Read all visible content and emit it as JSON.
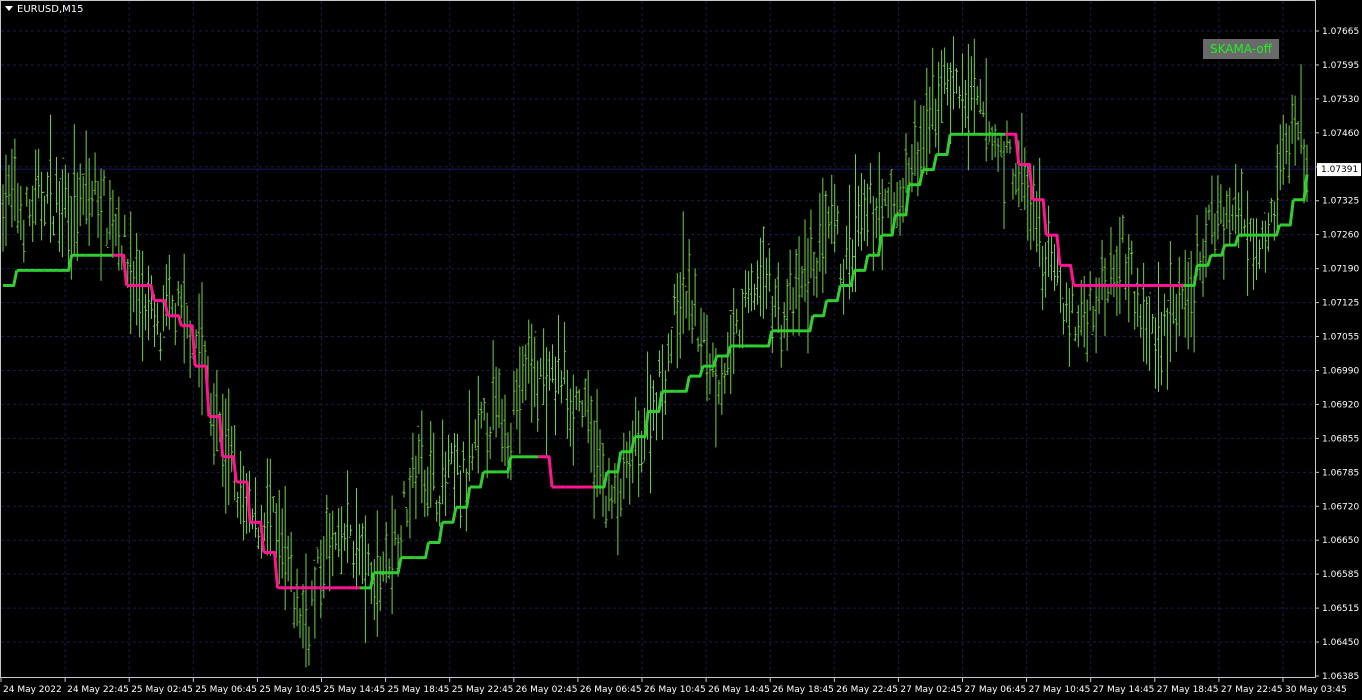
{
  "header": {
    "symbol": "EURUSD,M15"
  },
  "indicator_badge": {
    "label": "SKAMA-off",
    "color": "#1cf21c"
  },
  "colors": {
    "background": "#000000",
    "bars": "#6fd43a",
    "line_up": "#32cd32",
    "line_down": "#ff1493",
    "grid": "#1a1a4a",
    "price_line": "#1a1a6a",
    "text": "#ffffff"
  },
  "chart_data": {
    "type": "line",
    "title": "EURUSD,M15",
    "grid": true,
    "ylim": [
      1.0638,
      1.0772
    ],
    "y_ticks": [
      "1.07665",
      "1.07595",
      "1.07530",
      "1.07460",
      "1.07391",
      "1.07325",
      "1.07260",
      "1.07190",
      "1.07125",
      "1.07055",
      "1.06990",
      "1.06920",
      "1.06855",
      "1.06785",
      "1.06720",
      "1.06650",
      "1.06585",
      "1.06515",
      "1.06450",
      "1.06385"
    ],
    "x_ticks": [
      "24 May 2022",
      "24 May 22:45",
      "25 May 02:45",
      "25 May 06:45",
      "25 May 10:45",
      "25 May 14:45",
      "25 May 18:45",
      "25 May 22:45",
      "26 May 02:45",
      "26 May 06:45",
      "26 May 10:45",
      "26 May 14:45",
      "26 May 18:45",
      "26 May 22:45",
      "27 May 02:45",
      "27 May 06:45",
      "27 May 10:45",
      "27 May 14:45",
      "27 May 18:45",
      "27 May 22:45",
      "30 May 03:45"
    ],
    "current_price": "1.07391",
    "price_trace": [
      1.0734,
      1.0733,
      1.0729,
      1.0731,
      1.0735,
      1.0732,
      1.0734,
      1.073,
      1.0733,
      1.0734,
      1.073,
      1.0728,
      1.0719,
      1.0715,
      1.071,
      1.0705,
      1.0712,
      1.0709,
      1.0707,
      1.0703,
      1.069,
      1.0685,
      1.0678,
      1.0671,
      1.0668,
      1.0672,
      1.0666,
      1.066,
      1.0652,
      1.065,
      1.0658,
      1.0665,
      1.0663,
      1.0668,
      1.0662,
      1.0656,
      1.066,
      1.0664,
      1.067,
      1.0678,
      1.0682,
      1.0676,
      1.0677,
      1.0679,
      1.0676,
      1.0684,
      1.0689,
      1.0691,
      1.0688,
      1.0694,
      1.07,
      1.0698,
      1.0695,
      1.0699,
      1.0694,
      1.0693,
      1.0685,
      1.0678,
      1.0672,
      1.0676,
      1.0683,
      1.0687,
      1.0694,
      1.07,
      1.071,
      1.0716,
      1.0708,
      1.0702,
      1.0698,
      1.07,
      1.0707,
      1.0714,
      1.0718,
      1.0716,
      1.0708,
      1.0712,
      1.0716,
      1.072,
      1.0724,
      1.0727,
      1.0718,
      1.0725,
      1.0729,
      1.0732,
      1.073,
      1.0733,
      1.0737,
      1.0742,
      1.0746,
      1.0755,
      1.0757,
      1.0754,
      1.0752,
      1.075,
      1.0745,
      1.0742,
      1.074,
      1.0736,
      1.0729,
      1.0722,
      1.0718,
      1.0712,
      1.0708,
      1.071,
      1.0714,
      1.0718,
      1.0724,
      1.0722,
      1.071,
      1.0707,
      1.0706,
      1.0712,
      1.0709,
      1.0714,
      1.072,
      1.073,
      1.0731,
      1.0729,
      1.073,
      1.0727,
      1.0728,
      1.0733,
      1.0743,
      1.0749,
      1.074
    ],
    "series": [
      {
        "name": "SKAMA",
        "kind": "adaptive-ma",
        "values": [
          1.0716,
          1.0719,
          1.0719,
          1.0719,
          1.0719,
          1.0722,
          1.0722,
          1.0722,
          1.0722,
          1.0716,
          1.0716,
          1.0713,
          1.071,
          1.0708,
          1.07,
          1.069,
          1.0682,
          1.0677,
          1.0669,
          1.0663,
          1.0656,
          1.0656,
          1.0656,
          1.0656,
          1.0656,
          1.0656,
          1.0656,
          1.0659,
          1.0659,
          1.0662,
          1.0662,
          1.0665,
          1.0669,
          1.0672,
          1.0676,
          1.0679,
          1.0679,
          1.0682,
          1.0682,
          1.0682,
          1.0676,
          1.0676,
          1.0676,
          1.0676,
          1.0679,
          1.0683,
          1.0686,
          1.0691,
          1.0695,
          1.0695,
          1.0698,
          1.07,
          1.0702,
          1.0704,
          1.0704,
          1.0704,
          1.0707,
          1.0707,
          1.0707,
          1.071,
          1.0713,
          1.0716,
          1.0719,
          1.0722,
          1.0726,
          1.073,
          1.0736,
          1.0739,
          1.0742,
          1.0746,
          1.0746,
          1.0746,
          1.0746,
          1.0746,
          1.074,
          1.0733,
          1.0726,
          1.072,
          1.0716,
          1.0716,
          1.0716,
          1.0716,
          1.0716,
          1.0716,
          1.0716,
          1.0716,
          1.0716,
          1.072,
          1.0722,
          1.0724,
          1.0726,
          1.0726,
          1.0726,
          1.0728,
          1.0733,
          1.0738
        ]
      }
    ]
  }
}
